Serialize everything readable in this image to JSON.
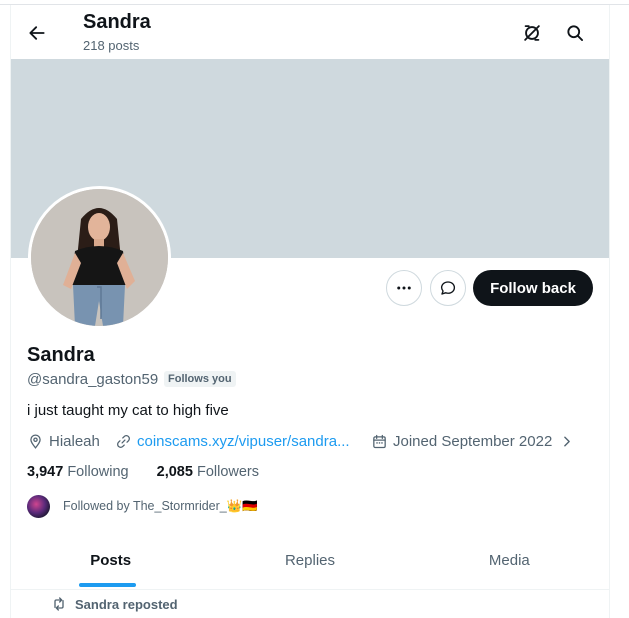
{
  "header": {
    "name": "Sandra",
    "posts": "218 posts",
    "back_icon": "arrow-left-icon",
    "no_notify_icon": "notifications-off-icon",
    "search_icon": "search-icon"
  },
  "profile": {
    "display_name": "Sandra",
    "handle": "@sandra_gaston59",
    "follows_you": "Follows you",
    "bio": "i just taught my cat to high five",
    "location": "Hialeah",
    "website": "coinscams.xyz/vipuser/sandra...",
    "joined": "Joined September 2022",
    "following_count": "3,947",
    "following_label": "Following",
    "followers_count": "2,085",
    "followers_label": "Followers",
    "followed_by": "Followed by The_Stormrider_👑🇩🇪"
  },
  "actions": {
    "more": "more-icon",
    "message": "message-icon",
    "follow_back": "Follow back"
  },
  "tabs": [
    {
      "label": "Posts",
      "active": true
    },
    {
      "label": "Replies",
      "active": false
    },
    {
      "label": "Media",
      "active": false
    }
  ],
  "feed": {
    "repost_label": "Sandra reposted"
  },
  "colors": {
    "accent": "#1d9bf0",
    "banner": "#cfd9de",
    "text": "#0f1419",
    "muted": "#536471"
  }
}
